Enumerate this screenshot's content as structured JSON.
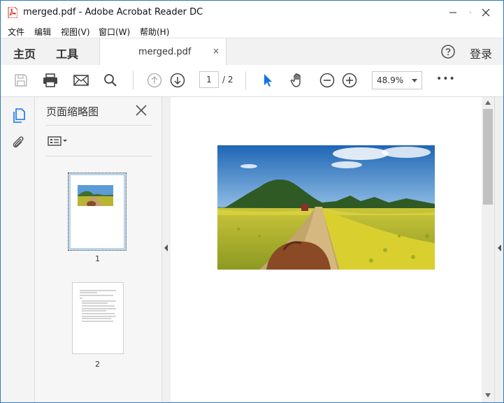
{
  "window": {
    "title": "merged.pdf - Adobe Acrobat Reader DC"
  },
  "menu": [
    "文件",
    "编辑",
    "视图(V)",
    "窗口(W)",
    "帮助(H)"
  ],
  "tabs": {
    "home": "主页",
    "tools": "工具",
    "document": "merged.pdf",
    "close_glyph": "×"
  },
  "account": {
    "login": "登录",
    "help_icon": "question-circle-icon"
  },
  "toolbar": {
    "page_current": "1",
    "page_total": "/ 2",
    "zoom": "48.9%",
    "more": "•••",
    "icons": [
      "save-icon",
      "print-icon",
      "email-icon",
      "search-icon",
      "prev-page-icon",
      "next-page-icon",
      "select-cursor-icon",
      "hand-tool-icon",
      "zoom-out-icon",
      "zoom-in-icon",
      "more-icon"
    ]
  },
  "thumbnails": {
    "title": "页面缩略图",
    "pages": [
      {
        "label": "1",
        "selected": true
      },
      {
        "label": "2",
        "selected": false
      }
    ]
  },
  "colors": {
    "accent": "#1473e6",
    "frame": "#2b79c2",
    "selection": "#bcd6ec"
  }
}
